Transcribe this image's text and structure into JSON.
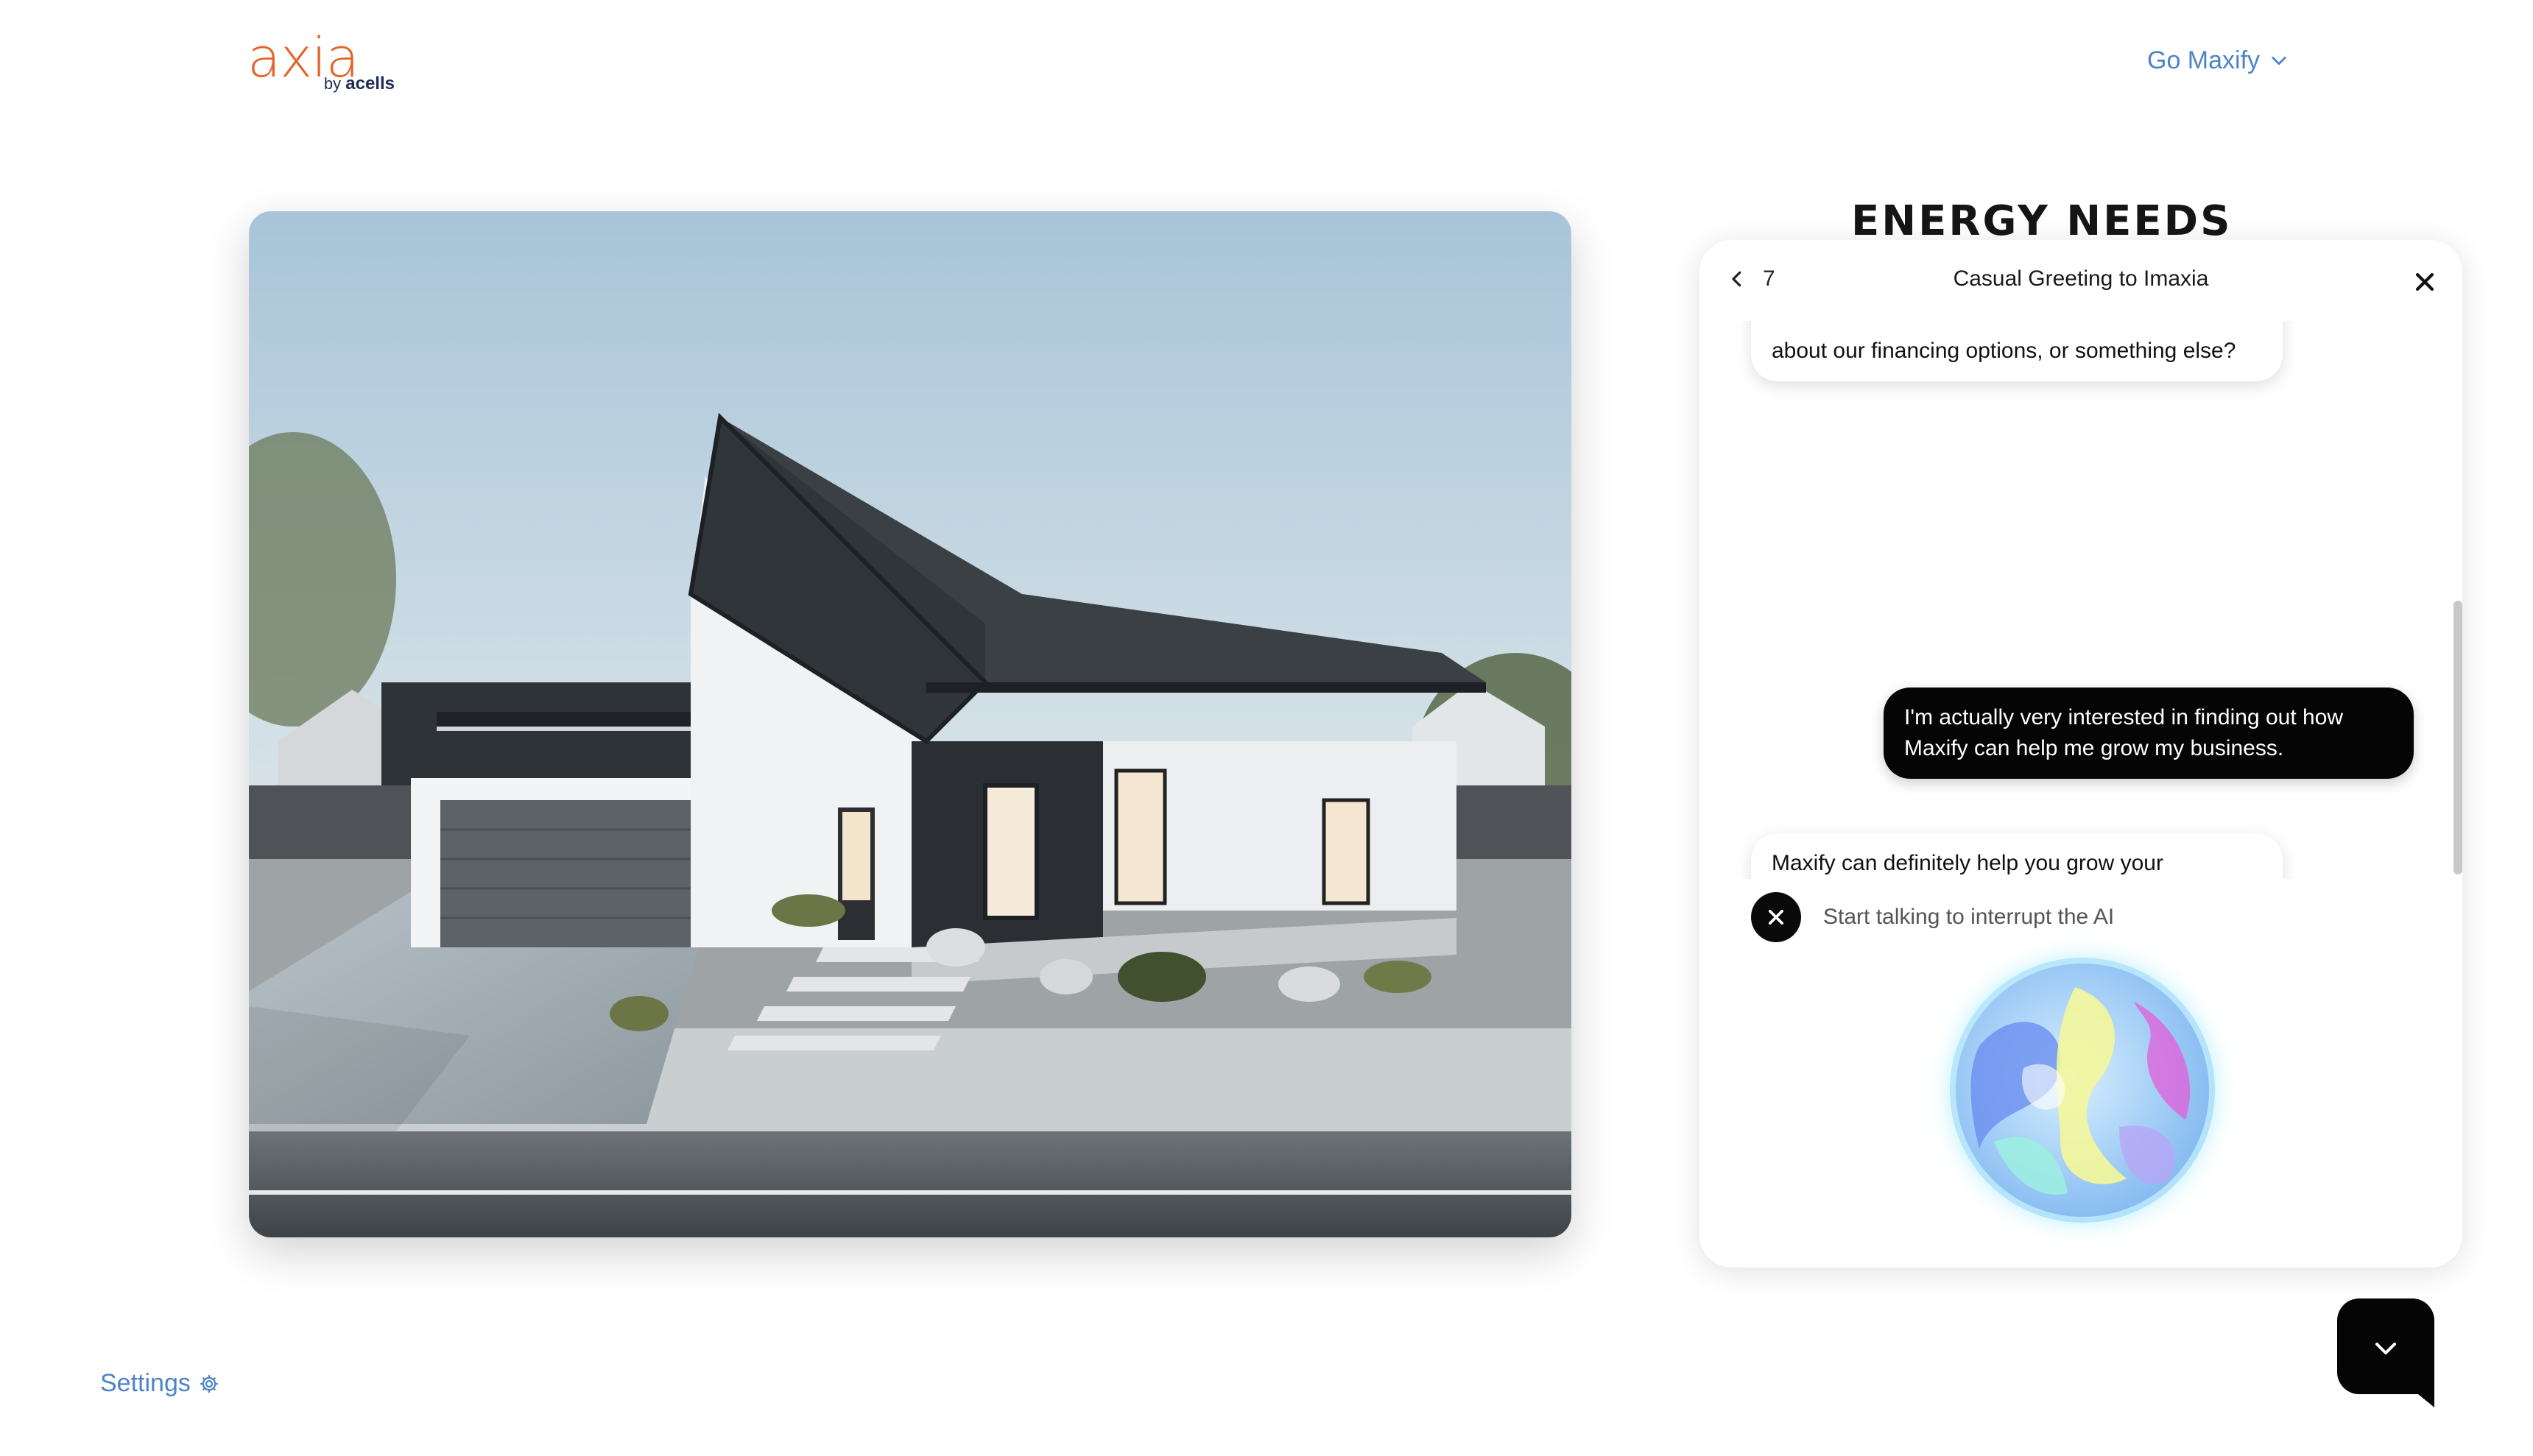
{
  "header": {
    "logo_word": "axia",
    "logo_by": "by ",
    "logo_company": "acells",
    "go_menu_label": "Go Maxify",
    "brand_color": "#e2652b",
    "link_color": "#4d84c8"
  },
  "section": {
    "title": "ENERGY NEEDS"
  },
  "chat": {
    "title": "Casual Greeting to Imaxia",
    "back_count": "7",
    "messages": [
      {
        "role": "ai",
        "text": "about our financing options, or something else?"
      },
      {
        "role": "user",
        "text": "I'm actually very interested in finding out how Maxify can help me grow my business."
      },
      {
        "role": "ai",
        "text": "Maxify can definitely help you grow your business! It's designed to generate complete solar deals in just ten seconds, which lets your sales team focus on closing. Plus, it's super intuitive, so there's zero training required. Are you interested in learning more about how it works or perhaps seeing a demo?"
      }
    ],
    "interrupt_text": "Start talking to interrupt the AI"
  },
  "footer": {
    "settings_label": "Settings"
  },
  "icons": {
    "go_menu": "chevron-down-icon",
    "back": "chevron-left-icon",
    "close": "close-icon",
    "interrupt": "close-icon",
    "settings": "gear-icon",
    "collapse": "chevron-down-icon"
  }
}
